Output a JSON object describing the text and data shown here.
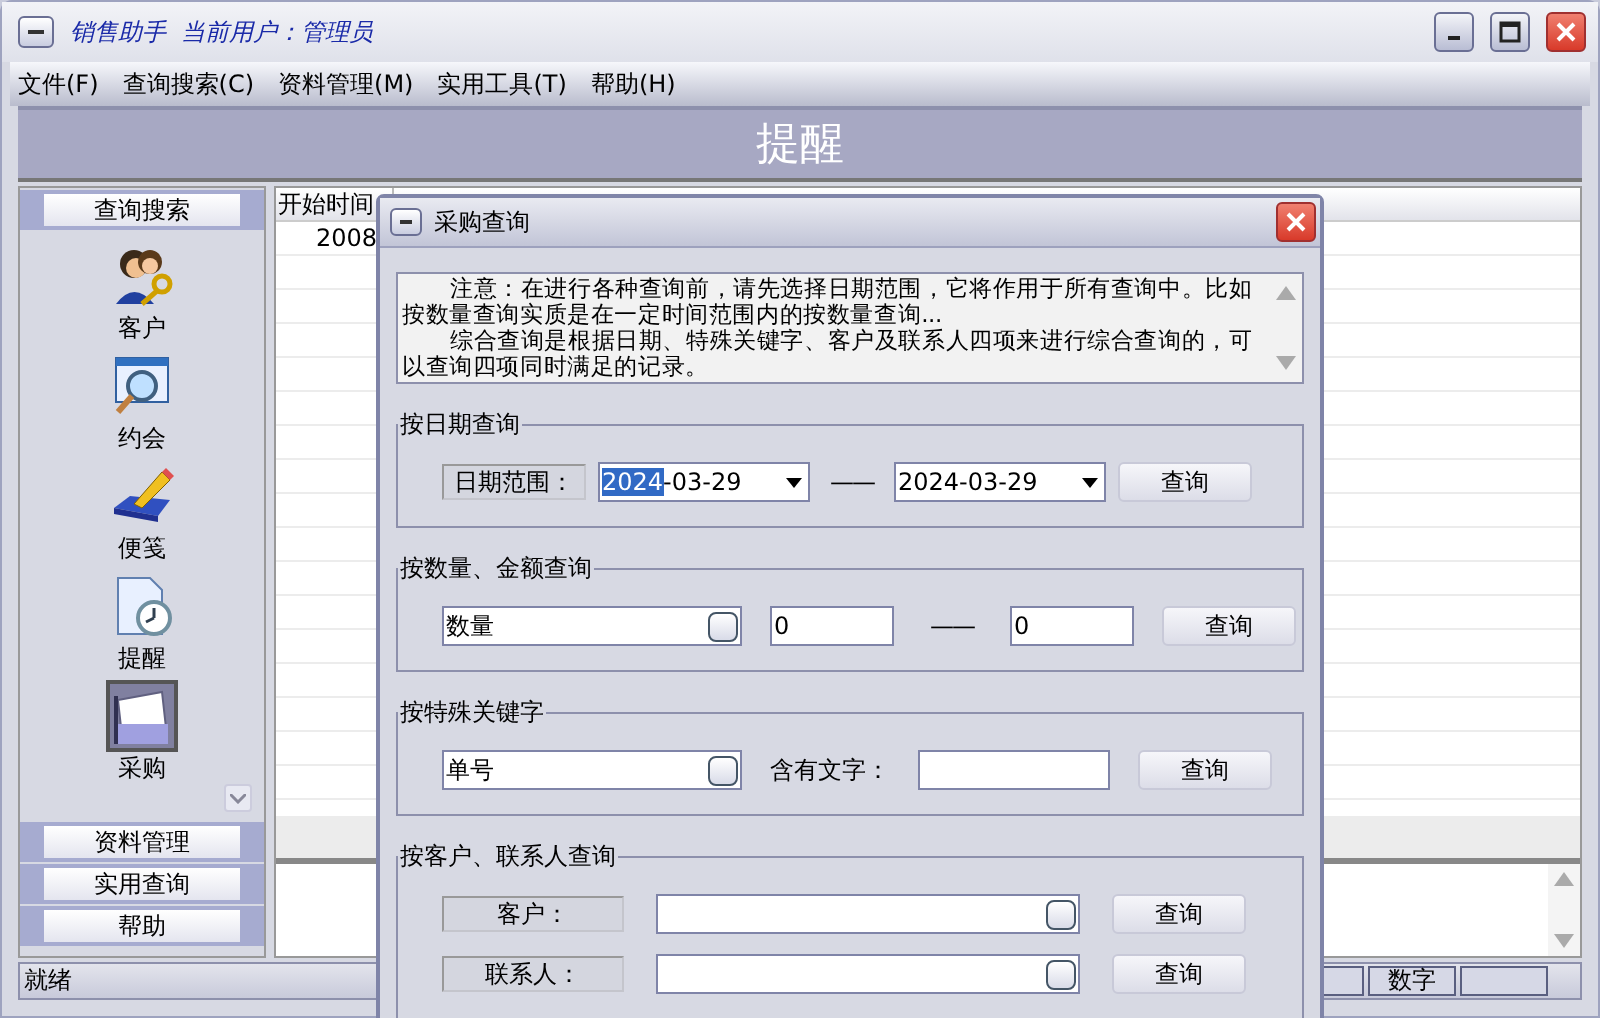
{
  "window": {
    "title": "销售助手  当前用户：管理员"
  },
  "menu": [
    {
      "label": "文件(F)"
    },
    {
      "label": "查询搜索(C)"
    },
    {
      "label": "资料管理(M)"
    },
    {
      "label": "实用工具(T)"
    },
    {
      "label": "帮助(H)"
    }
  ],
  "banner": "提醒",
  "sidebar": {
    "top_group": "查询搜索",
    "items": [
      {
        "label": "客户",
        "kind": "people",
        "selected": false
      },
      {
        "label": "约会",
        "kind": "magnifier",
        "selected": false
      },
      {
        "label": "便笺",
        "kind": "pencil",
        "selected": false
      },
      {
        "label": "提醒",
        "kind": "clock",
        "selected": false
      },
      {
        "label": "采购",
        "kind": "tray",
        "selected": true
      }
    ],
    "bottom_groups": [
      "资料管理",
      "实用查询",
      "帮助"
    ]
  },
  "table": {
    "columns": [
      "开始时间"
    ],
    "rows": [
      [
        "2008"
      ]
    ]
  },
  "status_bar": {
    "text": "就绪",
    "panels": [
      "数字"
    ]
  },
  "dialog": {
    "title": "采购查询",
    "notice": [
      "注意：在进行各种查询前，请先选择日期范围，它将作用于所有查询中。比如按数量查询实质是在一定时间范围内的按数量查询...",
      "综合查询是根据日期、特殊关键字、客户及联系人四项来进行综合查询的，可以查询四项同时满足的记录。"
    ],
    "groups": [
      {
        "kind": "date",
        "title": "按日期查询",
        "label": "日期范围：",
        "from": [
          {
            "text": "2024",
            "selected": true
          },
          {
            "text": "-03-29",
            "selected": false
          }
        ],
        "separator": "——",
        "to": "2024-03-29",
        "button": "查询"
      },
      {
        "kind": "amount",
        "title": "按数量、金额查询",
        "field": "数量",
        "from": "0",
        "separator": "——",
        "to": "0",
        "button": "查询"
      },
      {
        "kind": "keyword",
        "title": "按特殊关键字",
        "field": "单号",
        "label": "含有文字：",
        "button": "查询"
      },
      {
        "kind": "contact",
        "title": "按客户、联系人查询",
        "rows": [
          {
            "label": "客户：",
            "button": "查询"
          },
          {
            "label": "联系人：",
            "button": "查询"
          }
        ]
      }
    ]
  }
}
